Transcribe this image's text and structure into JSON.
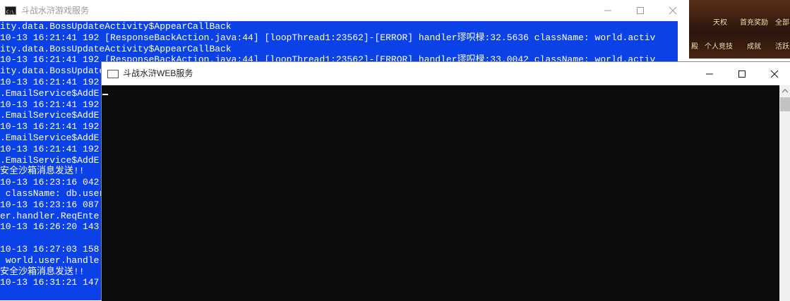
{
  "back_window": {
    "title": "斗战水浒游戏服务",
    "lines": [
      "ity.data.BossUpdateActivity$AppearCallBack",
      "10-13 16:21:41 192 [ResponseBackAction.java:44] [loopThread1:23562]-[ERROR] handler璆呮椂:32.5636 className: world.activ",
      "ity.data.BossUpdateActivity$AppearCallBack",
      "10-13 16:21:41 192 [ResponseBackAction.java:44] [loopThread1:23562]-[ERROR] handler璆呮椂:33.0042 className: world.activ",
      "ity.data.BossUpdateActivity$AppearCallBack",
      "10-13 16:21:41 192",
      ".EmailService$AddE",
      "10-13 16:21:41 192",
      ".EmailService$AddE",
      "10-13 16:21:41 192",
      ".EmailService$AddE",
      "10-13 16:21:41 192",
      ".EmailService$AddE",
      "安全沙箱消息发送!!",
      "10-13 16:23:16 042",
      " className: db.user",
      "10-13 16:23:16 087",
      "er.handler.ReqEnte",
      "10-13 16:26:20 143",
      "",
      "10-13 16:27:03 158",
      " world.user.handle",
      "安全沙箱消息发送!!",
      "10-13 16:31:21 147"
    ]
  },
  "front_window": {
    "title": "斗战水浒WEB服务"
  },
  "game_overlay": {
    "labels": [
      "天权",
      "首充奖励",
      "全部",
      "个人竞技",
      "成就",
      "活跃",
      "殿"
    ]
  }
}
